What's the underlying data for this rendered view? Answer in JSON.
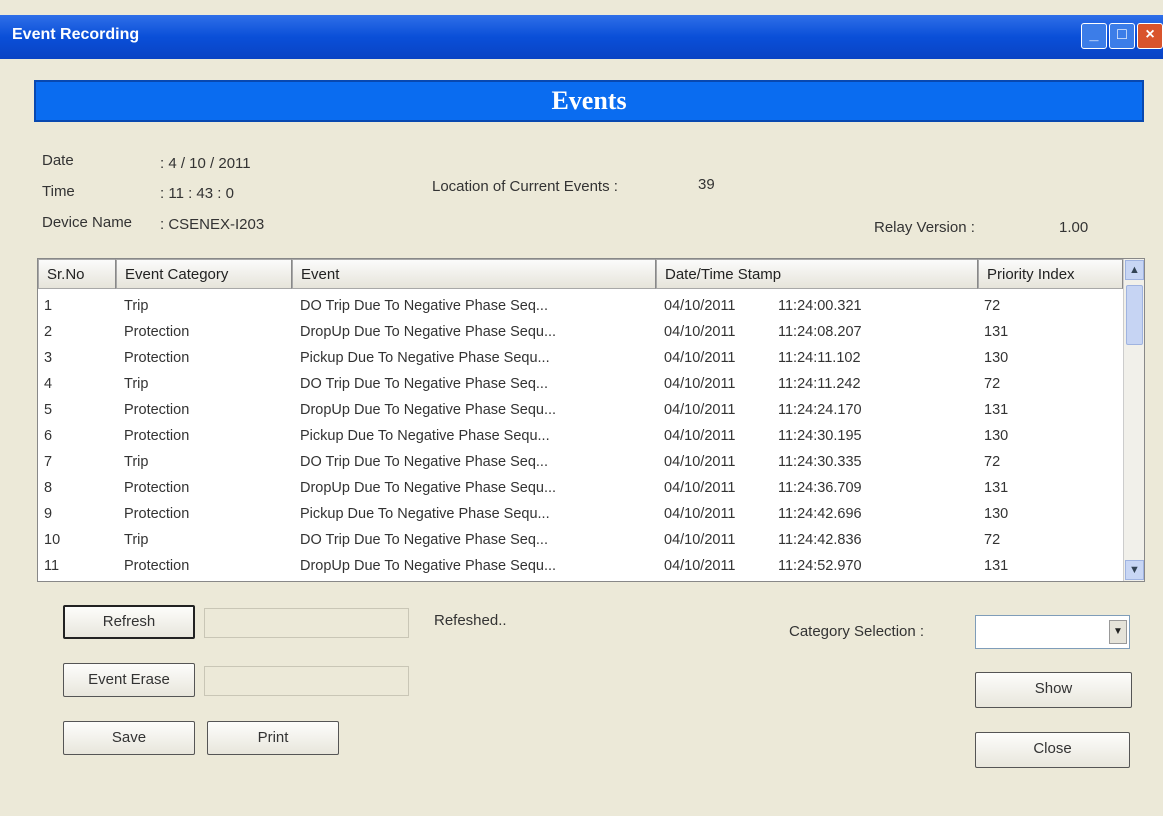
{
  "window": {
    "title": "Event Recording"
  },
  "banner": "Events",
  "info": {
    "date_label": "Date",
    "date_value": ": 4 / 10 / 2011",
    "time_label": "Time",
    "time_value": ": 11 : 43 : 0",
    "device_label": "Device Name",
    "device_value": ": CSENEX-I203",
    "location_label": "Location of Current Events :",
    "location_value": "39",
    "relay_label": "Relay Version :",
    "relay_value": "1.00"
  },
  "table": {
    "headers": [
      "Sr.No",
      "Event Category",
      "Event",
      "Date/Time Stamp",
      "Priority Index"
    ],
    "rows": [
      {
        "sr": "1",
        "cat": "Trip",
        "event": "DO Trip Due To Negative Phase Seq...",
        "date": "04/10/2011",
        "time": "11:24:00.321",
        "pri": "72"
      },
      {
        "sr": "2",
        "cat": "Protection",
        "event": "DropUp Due To Negative Phase Sequ...",
        "date": "04/10/2011",
        "time": "11:24:08.207",
        "pri": "131"
      },
      {
        "sr": "3",
        "cat": "Protection",
        "event": "Pickup Due To Negative Phase Sequ...",
        "date": "04/10/2011",
        "time": "11:24:11.102",
        "pri": "130"
      },
      {
        "sr": "4",
        "cat": "Trip",
        "event": "DO Trip Due To Negative Phase Seq...",
        "date": "04/10/2011",
        "time": "11:24:11.242",
        "pri": "72"
      },
      {
        "sr": "5",
        "cat": "Protection",
        "event": "DropUp Due To Negative Phase Sequ...",
        "date": "04/10/2011",
        "time": "11:24:24.170",
        "pri": "131"
      },
      {
        "sr": "6",
        "cat": "Protection",
        "event": "Pickup Due To Negative Phase Sequ...",
        "date": "04/10/2011",
        "time": "11:24:30.195",
        "pri": "130"
      },
      {
        "sr": "7",
        "cat": "Trip",
        "event": "DO Trip Due To Negative Phase Seq...",
        "date": "04/10/2011",
        "time": "11:24:30.335",
        "pri": "72"
      },
      {
        "sr": "8",
        "cat": "Protection",
        "event": "DropUp Due To Negative Phase Sequ...",
        "date": "04/10/2011",
        "time": "11:24:36.709",
        "pri": "131"
      },
      {
        "sr": "9",
        "cat": "Protection",
        "event": "Pickup Due To Negative Phase Sequ...",
        "date": "04/10/2011",
        "time": "11:24:42.696",
        "pri": "130"
      },
      {
        "sr": "10",
        "cat": "Trip",
        "event": "DO Trip Due To Negative Phase Seq...",
        "date": "04/10/2011",
        "time": "11:24:42.836",
        "pri": "72"
      },
      {
        "sr": "11",
        "cat": "Protection",
        "event": "DropUp Due To Negative Phase Sequ...",
        "date": "04/10/2011",
        "time": "11:24:52.970",
        "pri": "131"
      }
    ]
  },
  "controls": {
    "refresh": "Refresh",
    "refresh_status": "Refeshed..",
    "event_erase": "Event Erase",
    "save": "Save",
    "print": "Print",
    "category_label": "Category Selection :",
    "category_value": "",
    "show": "Show",
    "close": "Close"
  }
}
